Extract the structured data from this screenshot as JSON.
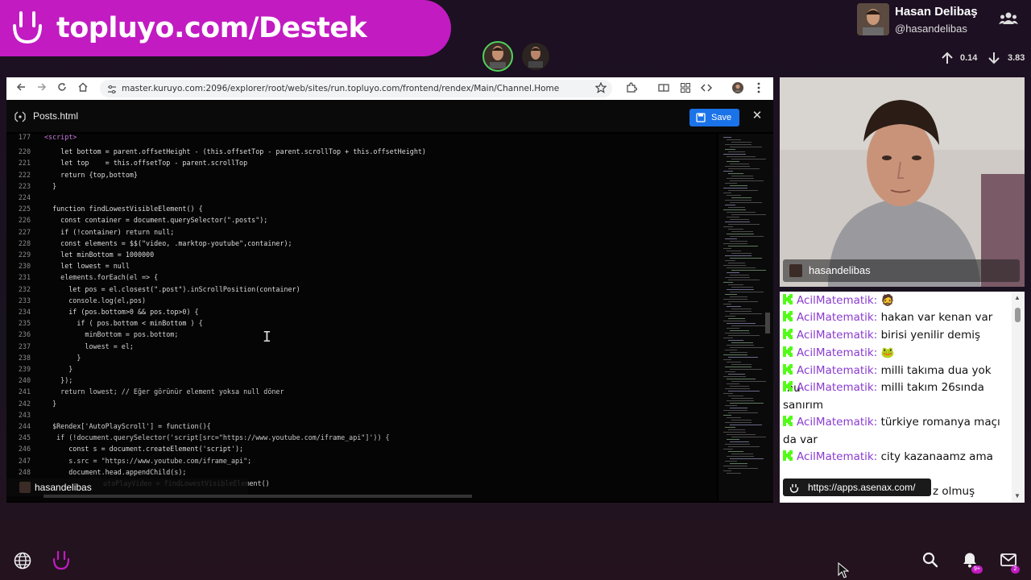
{
  "banner": {
    "text": "topluyo.com/Destek"
  },
  "profile": {
    "name": "Hasan Delibaş",
    "handle": "@hasandelibas"
  },
  "stats": {
    "up": "0.14",
    "down": "3.83"
  },
  "browser": {
    "url": "master.kuruyo.com:2096/explorer/root/web/sites/run.topluyo.com/frontend/rendex/Main/Channel.Home",
    "file_name": "Posts.html",
    "save_label": "Save",
    "close_label": "✕"
  },
  "code": [
    {
      "ln": "177",
      "text": "<script>"
    },
    {
      "ln": "220",
      "text": "    let bottom = parent.offsetHeight - (this.offsetTop - parent.scrollTop + this.offsetHeight)"
    },
    {
      "ln": "221",
      "text": "    let top    = this.offsetTop - parent.scrollTop"
    },
    {
      "ln": "222",
      "text": "    return {top,bottom}"
    },
    {
      "ln": "223",
      "text": "  }"
    },
    {
      "ln": "224",
      "text": ""
    },
    {
      "ln": "225",
      "text": "  function findLowestVisibleElement() {"
    },
    {
      "ln": "226",
      "text": "    const container = document.querySelector(\".posts\");"
    },
    {
      "ln": "227",
      "text": "    if (!container) return null;"
    },
    {
      "ln": "228",
      "text": "    const elements = $$(\"video, .marktop-youtube\",container);"
    },
    {
      "ln": "229",
      "text": "    let minBottom = 1000000"
    },
    {
      "ln": "230",
      "text": "    let lowest = null"
    },
    {
      "ln": "231",
      "text": "    elements.forEach(el => {"
    },
    {
      "ln": "232",
      "text": "      let pos = el.closest(\".post\").inScrollPosition(container)"
    },
    {
      "ln": "233",
      "text": "      console.log(el,pos)"
    },
    {
      "ln": "234",
      "text": "      if (pos.bottom>0 && pos.top>0) {"
    },
    {
      "ln": "235",
      "text": "        if ( pos.bottom < minBottom ) {"
    },
    {
      "ln": "236",
      "text": "          minBottom = pos.bottom;"
    },
    {
      "ln": "237",
      "text": "          lowest = el;"
    },
    {
      "ln": "238",
      "text": "        }"
    },
    {
      "ln": "239",
      "text": "      }"
    },
    {
      "ln": "240",
      "text": "    });"
    },
    {
      "ln": "241",
      "text": "    return lowest; // Eğer görünür element yoksa null döner"
    },
    {
      "ln": "242",
      "text": "  }"
    },
    {
      "ln": "243",
      "text": ""
    },
    {
      "ln": "244",
      "text": "  $Rendex['AutoPlayScroll'] = function(){"
    },
    {
      "ln": "245",
      "text": "   if (!document.querySelector('script[src=\"https://www.youtube.com/iframe_api\"]')) {"
    },
    {
      "ln": "246",
      "text": "      const s = document.createElement('script');"
    },
    {
      "ln": "247",
      "text": "      s.src = \"https://www.youtube.com/iframe_api\";"
    },
    {
      "ln": "248",
      "text": "      document.head.appendChild(s);"
    }
  ],
  "code_bottom_partial": "utoPlayVideo = findLowestVisibleElement()",
  "code_overlay_user": "hasandelibas",
  "webcam": {
    "tag_name": "hasandelibas"
  },
  "chat": {
    "messages": [
      {
        "user": "AcilMatematik:",
        "text": "🧔"
      },
      {
        "user": "AcilMatematik:",
        "text": "hakan var kenan var"
      },
      {
        "user": "AcilMatematik:",
        "text": "birisi yenilir demiş"
      },
      {
        "user": "AcilMatematik:",
        "text": "🐸"
      },
      {
        "user": "AcilMatematik:",
        "text": "milli takıma dua yok mu"
      },
      {
        "user": "AcilMatematik:",
        "text": "milli takım 26sında sanırım"
      },
      {
        "user": "AcilMatematik:",
        "text": "türkiye romanya maçı da var"
      },
      {
        "user": "AcilMatematik:",
        "text": "city kazanaamz ama"
      }
    ],
    "overlay_text": "https://apps.asenax.com/",
    "tail_text": "z olmuş"
  },
  "bottom_bar": {
    "notif_count": "9+",
    "mail_count": "2"
  },
  "colors": {
    "banner": "#c21bc2",
    "chat_username": "#8a3ad1",
    "kick_green": "#53fc18",
    "save_button": "#1a73e8"
  }
}
